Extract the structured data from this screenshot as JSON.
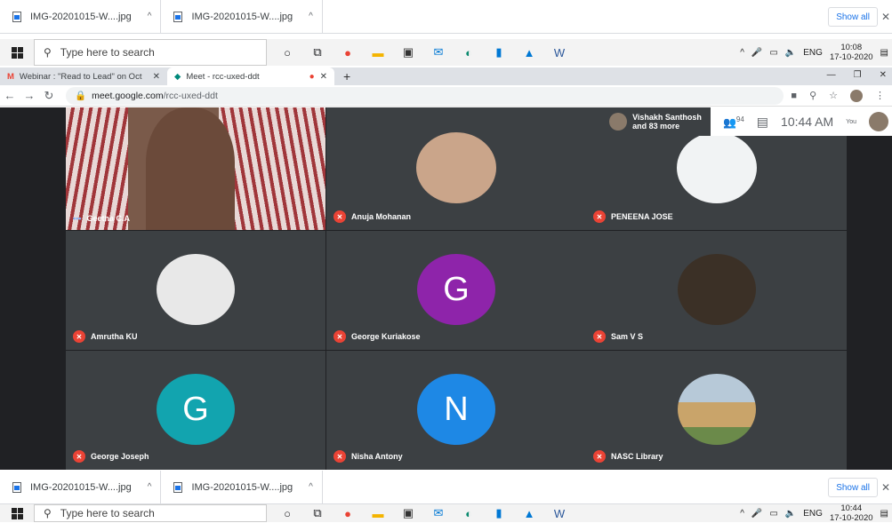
{
  "downloads_top": {
    "items": [
      "IMG-20201015-W....jpg",
      "IMG-20201015-W....jpg"
    ],
    "show_all": "Show all"
  },
  "taskbar_top": {
    "search_placeholder": "Type here to search",
    "tray_lang": "ENG",
    "time": "10:08",
    "date": "17-10-2020"
  },
  "browser": {
    "tabs": [
      {
        "label": "Webinar : \"Read to Lead\" on Oct"
      },
      {
        "label": "Meet - rcc-uxed-ddt"
      }
    ],
    "url_domain": "meet.google.com",
    "url_path": "/rcc-uxed-ddt"
  },
  "meet": {
    "presenter": {
      "name": "Vishakh Santhosh",
      "more": "and 83 more"
    },
    "participant_count": "94",
    "time": "10:44 AM",
    "you_label": "You",
    "tiles": [
      {
        "name": "Geetha C.A",
        "kind": "video"
      },
      {
        "name": "Anuja Mohanan",
        "kind": "photo",
        "color": "#caa58a"
      },
      {
        "name": "PENEENA JOSE",
        "kind": "photo",
        "color": "#f1f3f4"
      },
      {
        "name": "Amrutha KU",
        "kind": "photo",
        "color": "#e8e8e8"
      },
      {
        "name": "George Kuriakose",
        "kind": "letter",
        "letter": "G",
        "color": "#8e24aa"
      },
      {
        "name": "Sam V S",
        "kind": "photo",
        "color": "#3b3026"
      },
      {
        "name": "George Joseph",
        "kind": "letter",
        "letter": "G",
        "color": "#12a4af"
      },
      {
        "name": "Nisha Antony",
        "kind": "letter",
        "letter": "N",
        "color": "#1e88e5"
      },
      {
        "name": "NASC Library",
        "kind": "photo",
        "color": "#9a8a70"
      }
    ]
  },
  "downloads_bottom": {
    "items": [
      "IMG-20201015-W....jpg",
      "IMG-20201015-W....jpg"
    ],
    "show_all": "Show all"
  },
  "taskbar_bottom": {
    "search_placeholder": "Type here to search",
    "tray_lang": "ENG",
    "time": "10:44",
    "date": "17-10-2020"
  }
}
